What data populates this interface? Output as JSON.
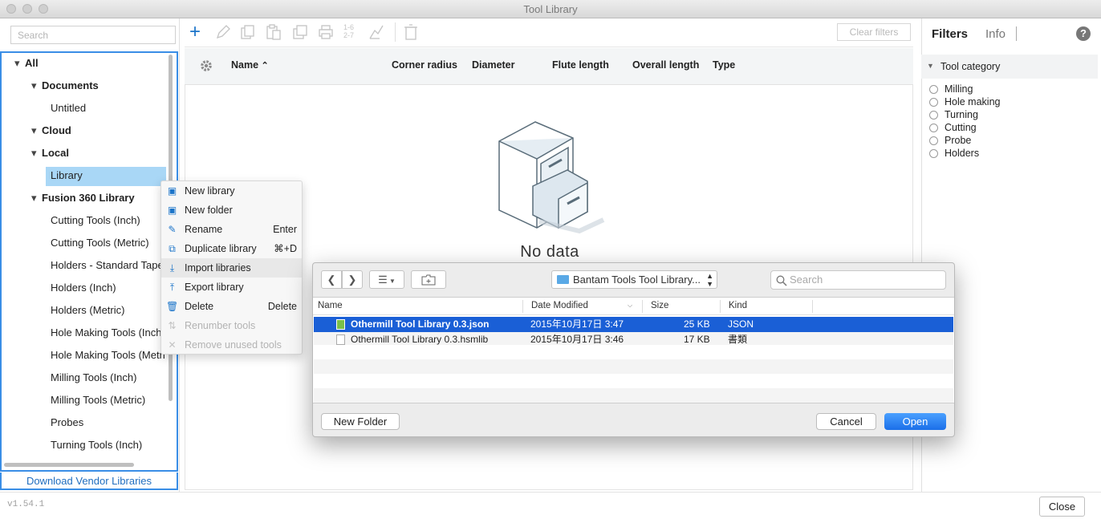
{
  "window": {
    "title": "Tool Library",
    "version": "v1.54.1",
    "close_label": "Close"
  },
  "sidebar": {
    "search_placeholder": "Search",
    "items": [
      {
        "label": "All",
        "level": 0,
        "expanded": true
      },
      {
        "label": "Documents",
        "level": 1,
        "expanded": true
      },
      {
        "label": "Untitled",
        "level": 2
      },
      {
        "label": "Cloud",
        "level": 1,
        "expanded": true
      },
      {
        "label": "Local",
        "level": 1,
        "expanded": true
      },
      {
        "label": "Library",
        "level": 2,
        "selected": true
      },
      {
        "label": "Fusion 360 Library",
        "level": 1,
        "expanded": true
      },
      {
        "label": "Cutting Tools (Inch)",
        "level": 2
      },
      {
        "label": "Cutting Tools (Metric)",
        "level": 2
      },
      {
        "label": "Holders - Standard Tape",
        "level": 2
      },
      {
        "label": "Holders (Inch)",
        "level": 2
      },
      {
        "label": "Holders (Metric)",
        "level": 2
      },
      {
        "label": "Hole Making Tools (Inch",
        "level": 2
      },
      {
        "label": "Hole Making Tools (Metri",
        "level": 2
      },
      {
        "label": "Milling Tools (Inch)",
        "level": 2
      },
      {
        "label": "Milling Tools (Metric)",
        "level": 2
      },
      {
        "label": "Probes",
        "level": 2
      },
      {
        "label": "Turning Tools (Inch)",
        "level": 2
      }
    ],
    "vendor_link": "Download Vendor Libraries"
  },
  "toolbar": {
    "clear_filters": "Clear filters"
  },
  "table": {
    "columns": [
      "Name",
      "Corner radius",
      "Diameter",
      "Flute length",
      "Overall length",
      "Type"
    ],
    "sort_column": "Name",
    "empty_text": "No data"
  },
  "filters": {
    "tabs": [
      "Filters",
      "Info"
    ],
    "section": "Tool category",
    "options": [
      "Milling",
      "Hole making",
      "Turning",
      "Cutting",
      "Probe",
      "Holders"
    ]
  },
  "context_menu": {
    "items": [
      {
        "label": "New library",
        "shortcut": "",
        "enabled": true
      },
      {
        "label": "New folder",
        "shortcut": "",
        "enabled": true
      },
      {
        "label": "Rename",
        "shortcut": "Enter",
        "enabled": true
      },
      {
        "label": "Duplicate library",
        "shortcut": "⌘+D",
        "enabled": true
      },
      {
        "label": "Import libraries",
        "shortcut": "",
        "enabled": true,
        "highlighted": true
      },
      {
        "label": "Export library",
        "shortcut": "",
        "enabled": true
      },
      {
        "label": "Delete",
        "shortcut": "Delete",
        "enabled": true
      },
      {
        "label": "Renumber tools",
        "shortcut": "",
        "enabled": false
      },
      {
        "label": "Remove unused tools",
        "shortcut": "",
        "enabled": false
      }
    ]
  },
  "dialog": {
    "location": "Bantam Tools Tool Library...",
    "search_placeholder": "Search",
    "columns": [
      "Name",
      "Date Modified",
      "Size",
      "Kind"
    ],
    "files": [
      {
        "name": "Othermill Tool Library 0.3.json",
        "date": "2015年10月17日 3:47",
        "size": "25 KB",
        "kind": "JSON",
        "selected": true
      },
      {
        "name": "Othermill Tool Library 0.3.hsmlib",
        "date": "2015年10月17日 3:46",
        "size": "17 KB",
        "kind": "書類",
        "selected": false
      }
    ],
    "new_folder": "New Folder",
    "cancel": "Cancel",
    "open": "Open"
  },
  "colors": {
    "accent": "#1b74c9",
    "selection": "#a9d7f6",
    "dialog_selection": "#1a5fd6"
  }
}
